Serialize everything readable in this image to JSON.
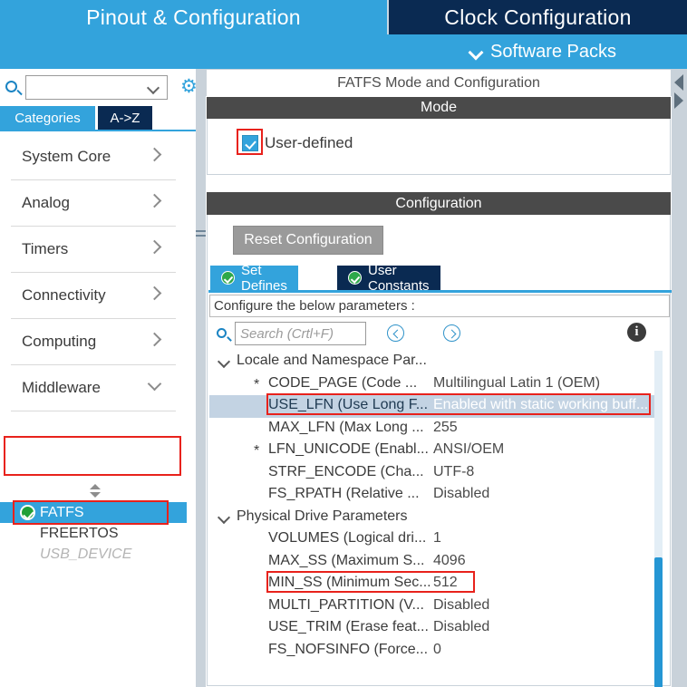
{
  "topbar": {
    "tabs": [
      {
        "label": "Pinout & Configuration",
        "active": true
      },
      {
        "label": "Clock Configuration",
        "active": false
      }
    ],
    "software_packs_label": "Software Packs",
    "chevron_icon": "chevron-down-icon"
  },
  "sidebar": {
    "search": {
      "value": "",
      "placeholder": ""
    },
    "gear_icon": "gear-icon",
    "search_icon": "search-icon",
    "view_tabs": [
      {
        "label": "Categories",
        "active": true
      },
      {
        "label": "A->Z",
        "active": false
      }
    ],
    "categories": [
      {
        "label": "System Core",
        "expanded": false
      },
      {
        "label": "Analog",
        "expanded": false
      },
      {
        "label": "Timers",
        "expanded": false
      },
      {
        "label": "Connectivity",
        "expanded": false
      },
      {
        "label": "Computing",
        "expanded": false
      },
      {
        "label": "Middleware",
        "expanded": true
      }
    ],
    "middleware_items": [
      {
        "label": "FATFS",
        "selected": true,
        "enabled": true,
        "status_icon": "green-check-icon"
      },
      {
        "label": "FREERTOS",
        "selected": false,
        "enabled": true
      },
      {
        "label": "USB_DEVICE",
        "selected": false,
        "enabled": false
      }
    ]
  },
  "content": {
    "panel_title": "FATFS Mode and Configuration",
    "mode": {
      "header": "Mode",
      "checkbox_label": "User-defined",
      "checked": true
    },
    "configuration": {
      "header": "Configuration",
      "reset_button": "Reset Configuration",
      "tabs": [
        {
          "label": "Set Defines",
          "active": true,
          "status_icon": "green-check-icon"
        },
        {
          "label": "User Constants",
          "active": false,
          "status_icon": "green-check-icon"
        }
      ],
      "note": "Configure the below parameters :",
      "search": {
        "value": "",
        "placeholder": "Search (Crtl+F)"
      },
      "nav_prev_icon": "circle-arrow-left-icon",
      "nav_next_icon": "circle-arrow-right-icon",
      "info_icon": "info-icon",
      "info_glyph": "i",
      "tree": [
        {
          "type": "group",
          "label": "Locale and Namespace Par...",
          "expanded": true
        },
        {
          "type": "param",
          "star": "*",
          "name": "CODE_PAGE (Code ...",
          "value": "Multilingual Latin 1 (OEM)",
          "selected": false
        },
        {
          "type": "param",
          "star": "",
          "name": "USE_LFN (Use Long F...",
          "value": "Enabled with static working buff...",
          "selected": true,
          "highlighted": true
        },
        {
          "type": "param",
          "star": "",
          "name": "MAX_LFN (Max Long ...",
          "value": "255",
          "selected": false
        },
        {
          "type": "param",
          "star": "*",
          "name": "LFN_UNICODE (Enabl...",
          "value": "ANSI/OEM",
          "selected": false
        },
        {
          "type": "param",
          "star": "",
          "name": "STRF_ENCODE (Cha...",
          "value": "UTF-8",
          "selected": false
        },
        {
          "type": "param",
          "star": "",
          "name": "FS_RPATH (Relative ...",
          "value": "Disabled",
          "selected": false
        },
        {
          "type": "group",
          "label": "Physical Drive Parameters",
          "expanded": true
        },
        {
          "type": "param",
          "star": "",
          "name": "VOLUMES (Logical dri...",
          "value": "1",
          "selected": false
        },
        {
          "type": "param",
          "star": "",
          "name": "MAX_SS (Maximum S...",
          "value": "4096",
          "selected": false,
          "highlighted": true
        },
        {
          "type": "param",
          "star": "",
          "name": "MIN_SS (Minimum Sec...",
          "value": "512",
          "selected": false
        },
        {
          "type": "param",
          "star": "",
          "name": "MULTI_PARTITION (V...",
          "value": "Disabled",
          "selected": false
        },
        {
          "type": "param",
          "star": "",
          "name": "USE_TRIM (Erase feat...",
          "value": "Disabled",
          "selected": false
        },
        {
          "type": "param",
          "star": "",
          "name": "FS_NOFSINFO (Force...",
          "value": "0",
          "selected": false
        }
      ]
    }
  },
  "colors": {
    "accent_blue": "#33a3dc",
    "dark_navy": "#0a2a52",
    "header_gray": "#4a4a4a",
    "highlight_red": "#e8221c",
    "selection_blue": "#c3d3e3",
    "green_check": "#21a038",
    "scrollbar_blue": "#2596d4"
  }
}
